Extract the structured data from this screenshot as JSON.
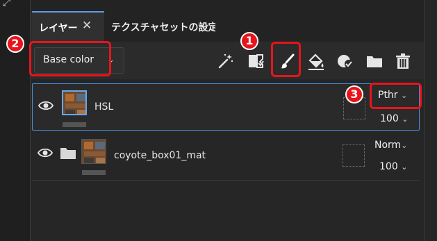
{
  "tabs": {
    "layers_label": "レイヤー",
    "close_glyph": "✕",
    "texture_label": "テクスチャセットの設定"
  },
  "channel_dropdown": {
    "value": "Base color",
    "chevron": "⌄"
  },
  "toolbar": {
    "tools": [
      "magic-wand-icon",
      "fill-mask-icon",
      "paint-brush-icon",
      "paint-bucket-icon",
      "smart-material-icon",
      "folder-icon",
      "trash-icon"
    ],
    "highlighted_tool": "paint-brush-icon"
  },
  "annotations": {
    "badge_1": "1",
    "badge_2": "2",
    "badge_3": "3",
    "highlight_color": "#e8141c"
  },
  "layers": [
    {
      "name": "HSL",
      "blend_mode": "Pthr",
      "opacity": "100",
      "selected": true
    },
    {
      "name": "coyote_box01_mat",
      "blend_mode": "Norm",
      "opacity": "100",
      "selected": false
    }
  ],
  "colors": {
    "accent": "#4a90d9",
    "background": "#2b2b2b"
  }
}
